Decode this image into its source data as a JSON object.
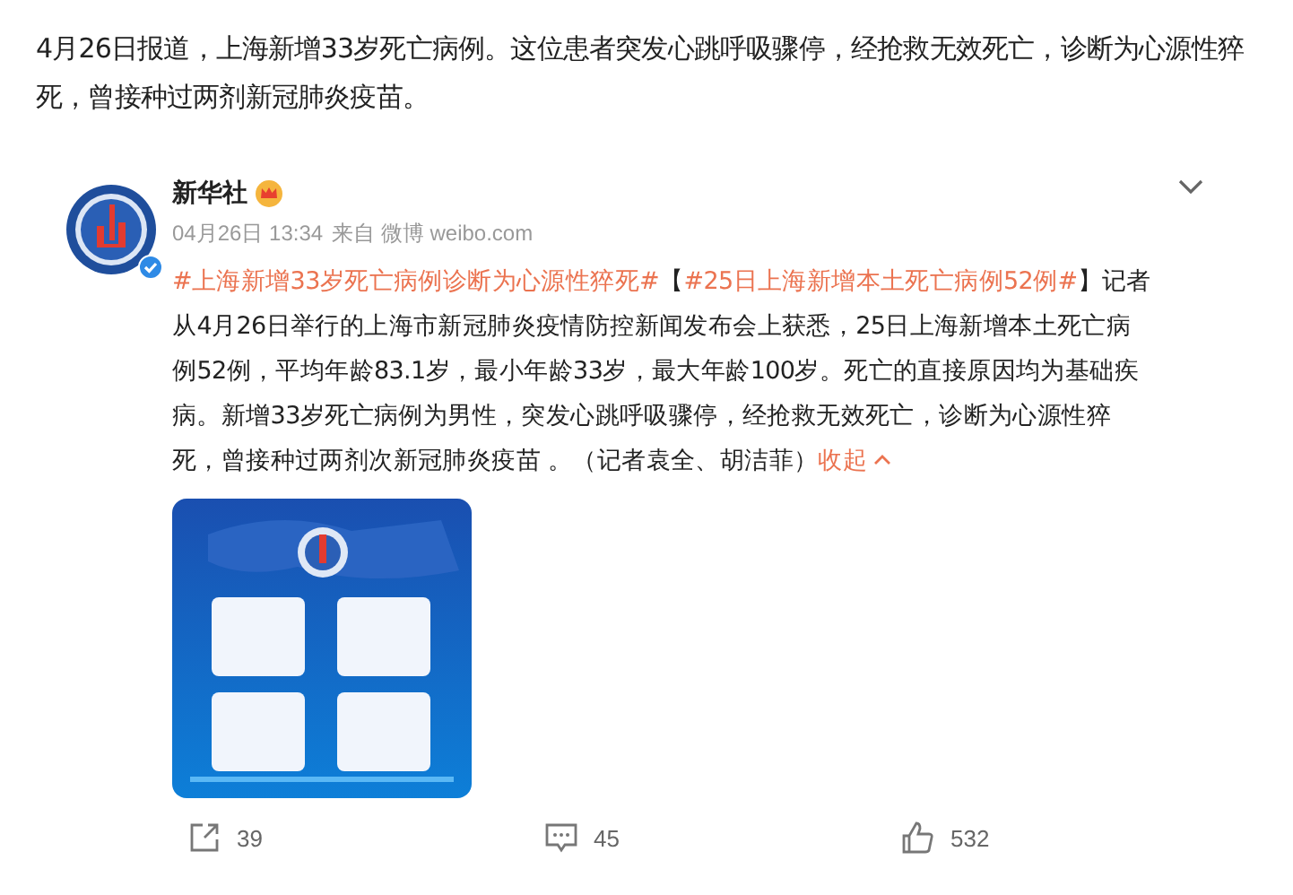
{
  "article": {
    "text": "4月26日报道，上海新增33岁死亡病例。这位患者突发心跳呼吸骤停，经抢救无效死亡，诊断为心源性猝死，曾接种过两剂新冠肺炎疫苗。"
  },
  "post": {
    "author": "新华社",
    "verified": true,
    "time": "04月26日 13:34",
    "source": "来自 微博 weibo.com",
    "body": [
      {
        "kind": "topic",
        "text": "#上海新增33岁死亡病例诊断为心源性猝死#"
      },
      {
        "kind": "text",
        "text": "【"
      },
      {
        "kind": "topic",
        "text": "#25日上海新增本土死亡病例52例#"
      },
      {
        "kind": "text",
        "text": "】记者从4月26日举行的上海市新冠肺炎疫情防控新闻发布会上获悉，25日上海新增本土死亡病例52例，平均年龄83.1岁，最小年龄33岁，最大年龄100岁。死亡的直接原因均为基础疾病。新增33岁死亡病例为男性，突发心跳呼吸骤停，经抢救无效死亡，诊断为心源性猝死，曾接种过两剂次新冠肺炎疫苗 。（记者袁全、胡洁菲）"
      },
      {
        "kind": "collapse",
        "text": "收起"
      }
    ],
    "actions": [
      {
        "kind": "share",
        "count": "39"
      },
      {
        "kind": "comment",
        "count": "45"
      },
      {
        "kind": "like",
        "count": "532"
      }
    ]
  }
}
